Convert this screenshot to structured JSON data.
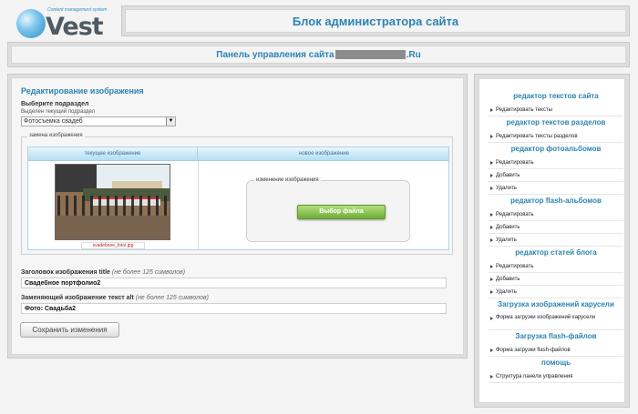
{
  "logo": {
    "tagline": "Content management system",
    "word": "Vest"
  },
  "header": {
    "title": "Блок администратора сайта"
  },
  "panel": {
    "prefix": "Панель управления сайта",
    "suffix": ".Ru"
  },
  "editor": {
    "title": "Редактирование изображения",
    "subsection_label": "Выберите подраздел",
    "subsection_hint": "Выделен текущий подраздел",
    "subsection_value": "Фотосъемка свадеб",
    "replace_legend": "замена изображения",
    "col_current": "текущее изображение",
    "col_new": "новое изображение",
    "current_filename": "svadebnoe_fotol.jpg",
    "upload_legend": "изменение изображения",
    "pick_file_label": "Выбор файла",
    "title_field_label": "Заголовок изображения title",
    "alt_field_label": "Заменяющий изображение текст alt",
    "limit_note": "(не более 125 символов)",
    "title_value": "Свадебное портфолио2",
    "alt_value": "Фото: Свадьба2",
    "save_label": "Сохранить изменения"
  },
  "sidebar": {
    "sections": [
      {
        "title": "редактор текстов сайта",
        "items": [
          "Редактировать тексты"
        ]
      },
      {
        "title": "редактор текстов разделов",
        "items": [
          "Редактировать тексты разделов"
        ]
      },
      {
        "title": "редактор фотоальбомов",
        "items": [
          "Редактировать",
          "Добавить",
          "Удалить"
        ]
      },
      {
        "title": "редактор flash-альбомов",
        "items": [
          "Редактировать",
          "Добавить",
          "Удалить"
        ]
      },
      {
        "title": "редактор статей блога",
        "items": [
          "Редактировать",
          "Добавить",
          "Удалить"
        ]
      },
      {
        "title": "Загрузка изображений карусели",
        "items": [
          "Форма загрузки изображений карусели"
        ]
      },
      {
        "title": "Загрузка flash-файлов",
        "items": [
          "Форма загрузки flash-файлов"
        ]
      },
      {
        "title": "помощь",
        "items": [
          "Структура панели управления"
        ]
      }
    ]
  }
}
